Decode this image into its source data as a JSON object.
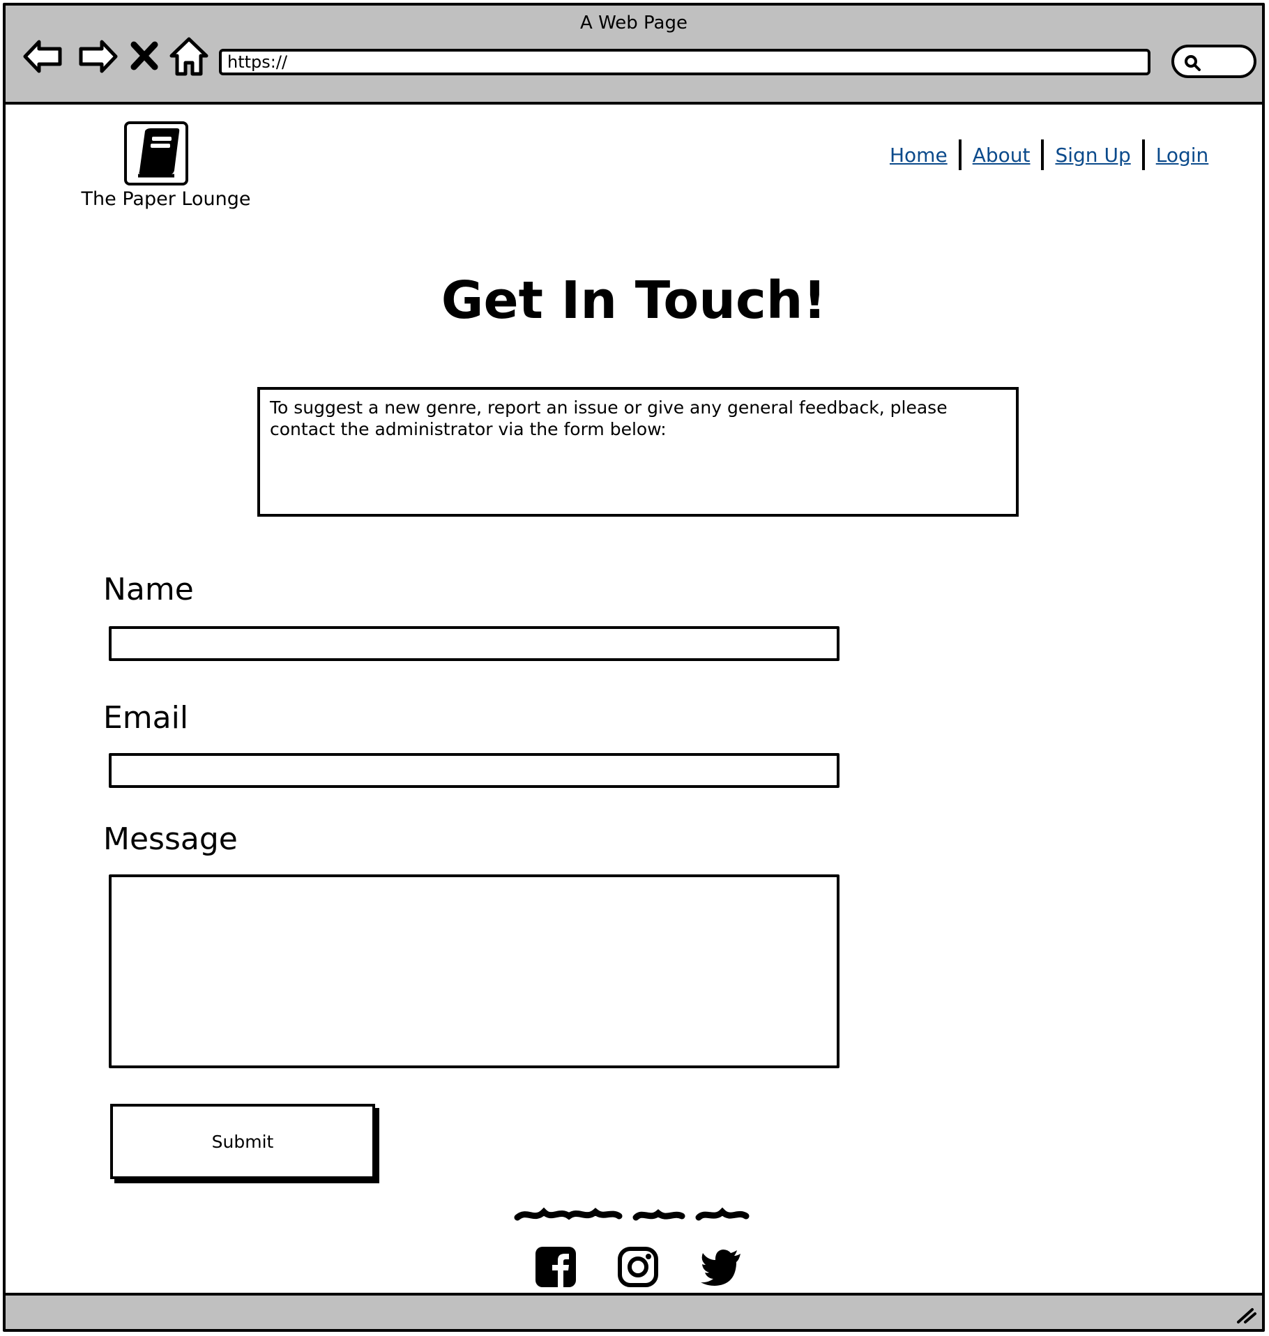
{
  "browser": {
    "window_title": "A Web Page",
    "url": "https://"
  },
  "icons": {
    "back": "back-arrow-icon",
    "forward": "forward-arrow-icon",
    "stop": "close-icon",
    "home": "home-icon",
    "search": "search-icon",
    "logo": "book-icon",
    "facebook": "facebook-icon",
    "instagram": "instagram-icon",
    "twitter": "twitter-icon",
    "resize": "resize-grip-icon"
  },
  "site": {
    "name": "The Paper Lounge"
  },
  "nav": {
    "items": [
      {
        "label": "Home"
      },
      {
        "label": "About"
      },
      {
        "label": "Sign Up"
      },
      {
        "label": "Login"
      }
    ]
  },
  "main": {
    "title": "Get In Touch!",
    "intro": "To suggest a new genre, report an issue or give any general feedback, please contact the administrator via the form below:"
  },
  "form": {
    "name_label": "Name",
    "name_value": "",
    "email_label": "Email",
    "email_value": "",
    "message_label": "Message",
    "message_value": "",
    "submit_label": "Submit"
  },
  "colors": {
    "chrome": "#c0c0c0",
    "link": "#0b4a8b",
    "ink": "#000000"
  }
}
